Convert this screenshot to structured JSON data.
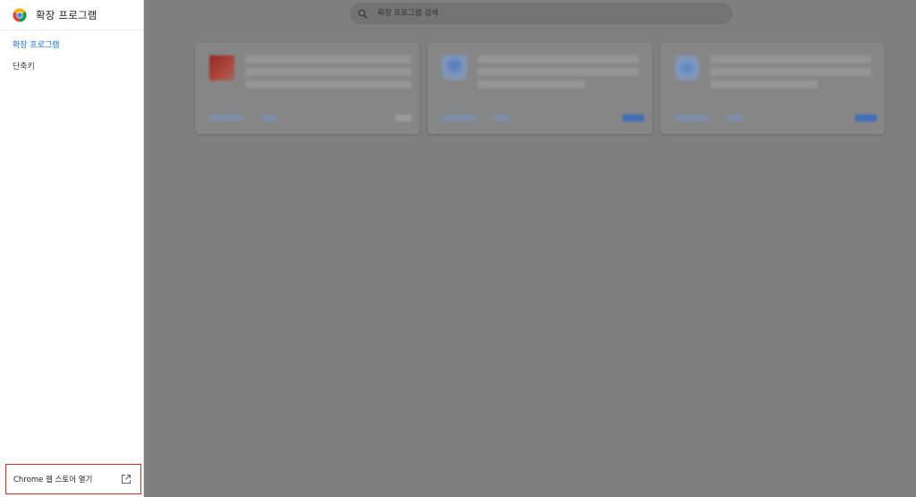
{
  "sidebar": {
    "title": "확장 프로그램",
    "items": [
      {
        "label": "확장 프로그램",
        "active": true
      },
      {
        "label": "단축키",
        "active": false
      }
    ],
    "store_link": {
      "label": "Chrome 웹 스토어 열기",
      "icon": "open-in-new-icon"
    }
  },
  "search": {
    "placeholder": "확장 프로그램 검색",
    "value": ""
  },
  "cards": [
    {
      "icon": "extension-icon",
      "icon_color": "#b0473c"
    },
    {
      "icon": "extension-icon",
      "icon_color": "#6f8cb8"
    },
    {
      "icon": "extension-icon",
      "icon_color": "#6f8cb8"
    }
  ],
  "colors": {
    "accent": "#1a73e8",
    "highlight_border": "#d93025",
    "overlay": "#7f7f7f"
  }
}
